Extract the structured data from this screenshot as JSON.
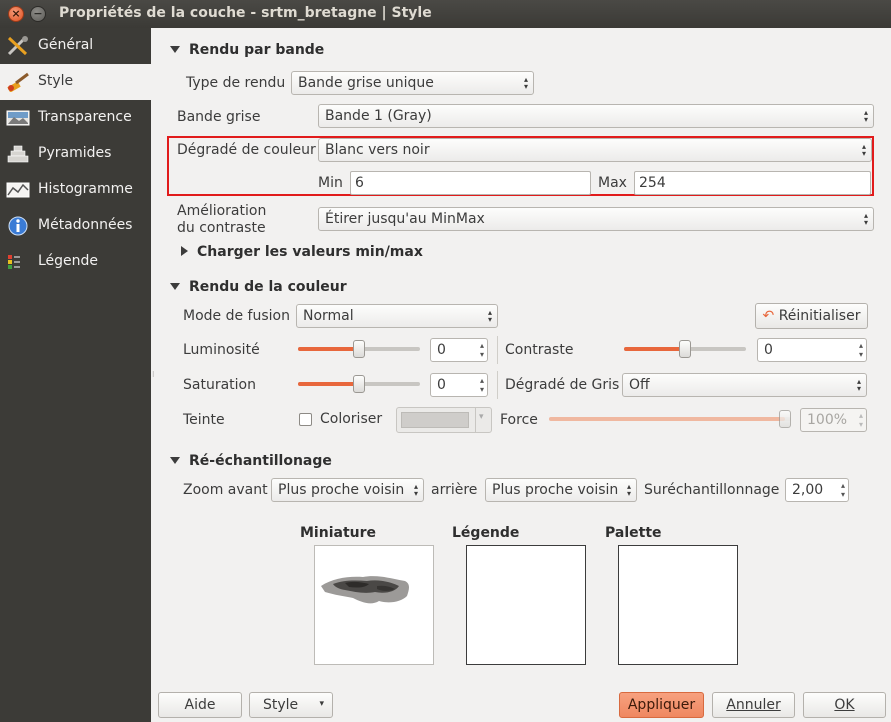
{
  "window": {
    "title": "Propriétés de la couche - srtm_bretagne | Style"
  },
  "sidebar": {
    "items": [
      {
        "label": "Général",
        "icon": "tools-icon"
      },
      {
        "label": "Style",
        "icon": "paintbrush-icon"
      },
      {
        "label": "Transparence",
        "icon": "transparency-icon"
      },
      {
        "label": "Pyramides",
        "icon": "pyramids-icon"
      },
      {
        "label": "Histogramme",
        "icon": "histogram-icon"
      },
      {
        "label": "Métadonnées",
        "icon": "info-icon"
      },
      {
        "label": "Légende",
        "icon": "legend-icon"
      }
    ]
  },
  "band_render": {
    "title": "Rendu par bande",
    "render_type_label": "Type de rendu",
    "render_type_value": "Bande grise unique",
    "gray_band_label": "Bande grise",
    "gray_band_value": "Bande 1 (Gray)",
    "gradient_label": "Dégradé de couleur",
    "gradient_value": "Blanc vers noir",
    "min_label": "Min",
    "min_value": "6",
    "max_label": "Max",
    "max_value": "254",
    "contrast_label_1": "Amélioration",
    "contrast_label_2": "du contraste",
    "contrast_value": "Étirer jusqu'au MinMax",
    "load_minmax": "Charger les valeurs min/max"
  },
  "color_render": {
    "title": "Rendu de la couleur",
    "blend_label": "Mode de fusion",
    "blend_value": "Normal",
    "reset_label": "Réinitialiser",
    "brightness_label": "Luminosité",
    "brightness_value": "0",
    "contrast_label": "Contraste",
    "contrast_value": "0",
    "saturation_label": "Saturation",
    "saturation_value": "0",
    "grayscale_label": "Dégradé de Gris",
    "grayscale_value": "Off",
    "hue_label": "Teinte",
    "colorize_label": "Coloriser",
    "strength_label": "Force",
    "strength_value": "100%",
    "brightness_level": 0.5,
    "contrast_level": 0.5,
    "saturation_level": 0.5,
    "strength_level": 1.0
  },
  "resampling": {
    "title": "Ré-échantillonage",
    "zoom_in_label": "Zoom avant",
    "zoom_in_value": "Plus proche voisin",
    "zoom_out_label": "arrière",
    "zoom_out_value": "Plus proche voisin",
    "oversampling_label": "Suréchantillonnage",
    "oversampling_value": "2,00"
  },
  "previews": {
    "thumbnail_label": "Miniature",
    "legend_label": "Légende",
    "palette_label": "Palette"
  },
  "footer": {
    "help": "Aide",
    "style": "Style",
    "apply": "Appliquer",
    "cancel": "Annuler",
    "ok": "OK"
  },
  "colors": {
    "accent": "#ef8760",
    "highlight": "#e11b1b",
    "sidebar": "#3c3b37",
    "slider_fill": "#e8673c"
  }
}
